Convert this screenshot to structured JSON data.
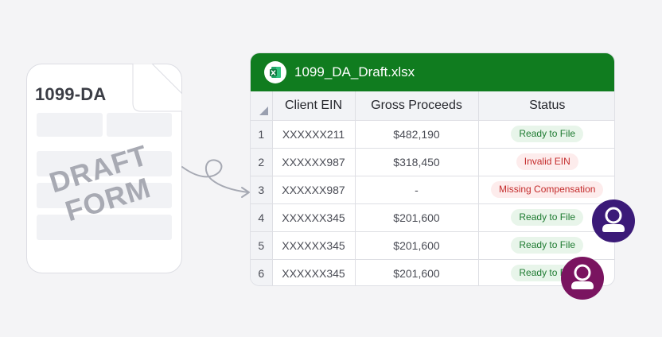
{
  "document": {
    "title": "1099-DA",
    "watermark_line1": "DRAFT",
    "watermark_line2": "FORM"
  },
  "spreadsheet": {
    "file_name": "1099_DA_Draft.xlsx",
    "app_icon": "excel-icon",
    "accent_color": "#107c1f",
    "columns": [
      "Client EIN",
      "Gross Proceeds",
      "Status"
    ],
    "rows": [
      {
        "num": "1",
        "ein": "XXXXXX211",
        "proceeds": "$482,190",
        "status": "Ready to File",
        "status_type": "ok"
      },
      {
        "num": "2",
        "ein": "XXXXXX987",
        "proceeds": "$318,450",
        "status": "Invalid EIN",
        "status_type": "err"
      },
      {
        "num": "3",
        "ein": "XXXXXX987",
        "proceeds": "-",
        "status": "Missing Compensation",
        "status_type": "err"
      },
      {
        "num": "4",
        "ein": "XXXXXX345",
        "proceeds": "$201,600",
        "status": "Ready to File",
        "status_type": "ok"
      },
      {
        "num": "5",
        "ein": "XXXXXX345",
        "proceeds": "$201,600",
        "status": "Ready to File",
        "status_type": "ok"
      },
      {
        "num": "6",
        "ein": "XXXXXX345",
        "proceeds": "$201,600",
        "status": "Ready to File",
        "status_type": "ok"
      }
    ]
  },
  "colors": {
    "ok_text": "#1d7a30",
    "ok_bg": "#e8f5ea",
    "err_text": "#c42b2b",
    "err_bg": "#fdecec"
  },
  "avatars": [
    {
      "icon": "user-avatar-icon",
      "color": "#3b1a78"
    },
    {
      "icon": "user-avatar-icon",
      "color": "#7a1460"
    }
  ]
}
